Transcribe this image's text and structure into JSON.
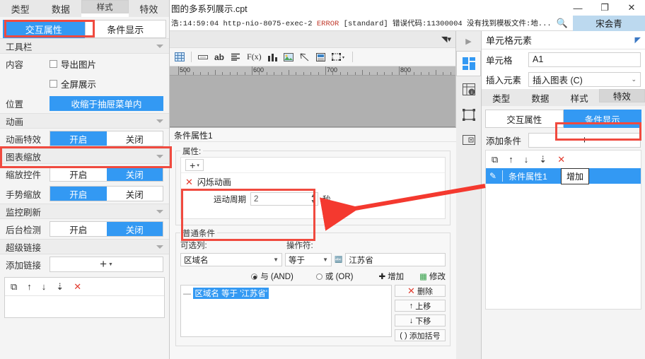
{
  "window": {
    "title": "图的多系列展示.cpt",
    "minimize": "—",
    "maximize": "❐",
    "close": "✕"
  },
  "log": {
    "prefix": "浩:14:59:04 http-nio-8075-exec-2 ",
    "level": "ERROR",
    "suffix": " [standard] 错误代码:11300004 没有找到模板文件:地...",
    "search_icon": "search-icon",
    "user": "宋会青"
  },
  "left_panel": {
    "tabs": [
      {
        "label": "类型",
        "selected": false
      },
      {
        "label": "数据",
        "selected": false
      },
      {
        "label": "样式",
        "selected": true
      },
      {
        "label": "特效",
        "selected": false
      }
    ],
    "subtabs": [
      {
        "label": "交互属性",
        "active": true
      },
      {
        "label": "条件显示",
        "active": false
      }
    ],
    "sections": [
      {
        "title": "工具栏",
        "rows": [
          {
            "type": "checkbox",
            "label": "内容",
            "text": "导出图片",
            "checked": false
          },
          {
            "type": "checkbox",
            "label": "",
            "text": "全屏展示",
            "checked": false
          },
          {
            "type": "bluebar",
            "label": "位置",
            "text": "收缩于抽屉菜单内"
          }
        ]
      },
      {
        "title": "动画",
        "rows": [
          {
            "type": "segment",
            "label": "动画特效",
            "on": "开启",
            "off": "关闭",
            "value": "on"
          }
        ]
      },
      {
        "title": "图表缩放",
        "rows": [
          {
            "type": "segment",
            "label": "缩放控件",
            "on": "开启",
            "off": "关闭",
            "value": "off"
          },
          {
            "type": "segment",
            "label": "手势缩放",
            "on": "开启",
            "off": "关闭",
            "value": "on"
          }
        ]
      },
      {
        "title": "监控刷新",
        "rows": [
          {
            "type": "segment",
            "label": "后台检测",
            "on": "开启",
            "off": "关闭",
            "value": "off"
          }
        ]
      },
      {
        "title": "超级链接",
        "rows": [
          {
            "type": "plus",
            "label": "添加链接",
            "text": "+"
          }
        ]
      }
    ],
    "list_tools": [
      "copy-icon",
      "move-up-icon",
      "move-down-icon",
      "sort-down-icon",
      "delete-icon"
    ]
  },
  "center": {
    "toolbar_icons": [
      "grid-icon",
      "textbox-icon",
      "ab-text-icon",
      "align-icon",
      "formula-icon",
      "chart-icon",
      "image-icon",
      "arrow-icon",
      "report-block-icon",
      "frame-icon"
    ],
    "toolbar_text_ab": "ab",
    "toolbar_text_fx": "F(x)",
    "collapse_icon": "collapse-panel-icon",
    "ruler": {
      "labels": [
        "500",
        "600",
        "700",
        "800"
      ],
      "unit_spacing": 100
    },
    "dialog": {
      "title": "条件属性1",
      "attr_legend": "属性:",
      "add_attr": "+",
      "attr_item": {
        "remove_icon": "remove-x-icon",
        "name": "闪烁动画",
        "period_label": "运动周期",
        "period_value": "2",
        "period_unit": "秒"
      },
      "common_legend": "普通条件",
      "col_label": "可选列:",
      "op_label": "操作符:",
      "col_value": "区域名",
      "op_value": "等于",
      "value_icon": "abc-format-icon",
      "value_text": "江苏省",
      "and_label": "与 (AND)",
      "or_label": "或 (OR)",
      "logic_value": "and",
      "add_button": "增加",
      "edit_button": "修改",
      "tree_node": "区域名 等于 '江苏省'",
      "tree_buttons": [
        {
          "icon": "delete-x-icon",
          "label": "删除"
        },
        {
          "icon": "up-arrow-icon",
          "label": "上移"
        },
        {
          "icon": "down-arrow-icon",
          "label": "下移"
        },
        {
          "icon": "paren-icon",
          "label": "添加括号"
        }
      ]
    }
  },
  "icon_strip": {
    "collapse_arrow": "expand-right-icon",
    "items": [
      "dashboard-grid-icon",
      "cell-info-icon",
      "frame-border-icon",
      "widget-dropdown-icon"
    ]
  },
  "right_panel": {
    "header": "单元格元素",
    "header_action_icon": "collapse-corner-icon",
    "cell_label": "单元格",
    "cell_value": "A1",
    "insert_label": "插入元素",
    "insert_value": "插入图表 (C)",
    "tabs": [
      {
        "label": "类型",
        "selected": false
      },
      {
        "label": "数据",
        "selected": false
      },
      {
        "label": "样式",
        "selected": false
      },
      {
        "label": "特效",
        "selected": true
      }
    ],
    "subtabs": [
      {
        "label": "交互属性",
        "active": false
      },
      {
        "label": "条件显示",
        "active": true
      }
    ],
    "add_condition_label": "添加条件",
    "add_condition_button": "+",
    "list_tools": [
      "copy-icon",
      "move-up-icon",
      "move-down-icon",
      "sort-down-icon",
      "delete-icon"
    ],
    "list_items": [
      {
        "icon": "edit-pencil-icon",
        "label": "条件属性1"
      }
    ],
    "tooltip": "增加"
  },
  "colors": {
    "accent": "#3399f3",
    "highlight": "#f04a3f",
    "arrow": "#f4392f",
    "user_chip": "#bcd9ef"
  }
}
